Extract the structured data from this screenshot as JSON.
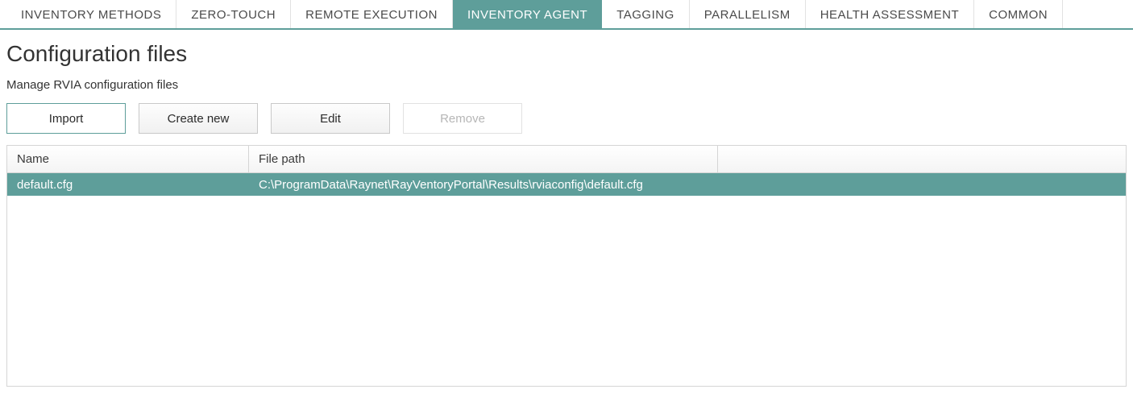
{
  "tabs": [
    {
      "label": "INVENTORY METHODS",
      "active": false
    },
    {
      "label": "ZERO-TOUCH",
      "active": false
    },
    {
      "label": "REMOTE EXECUTION",
      "active": false
    },
    {
      "label": "INVENTORY AGENT",
      "active": true
    },
    {
      "label": "TAGGING",
      "active": false
    },
    {
      "label": "PARALLELISM",
      "active": false
    },
    {
      "label": "HEALTH ASSESSMENT",
      "active": false
    },
    {
      "label": "COMMON",
      "active": false
    }
  ],
  "page": {
    "title": "Configuration files",
    "subtitle": "Manage RVIA configuration files"
  },
  "toolbar": {
    "import_label": "Import",
    "create_label": "Create new",
    "edit_label": "Edit",
    "remove_label": "Remove"
  },
  "grid": {
    "columns": {
      "name": "Name",
      "path": "File path"
    },
    "rows": [
      {
        "name": "default.cfg",
        "path": "C:\\ProgramData\\Raynet\\RayVentoryPortal\\Results\\rviaconfig\\default.cfg",
        "selected": true
      }
    ]
  }
}
